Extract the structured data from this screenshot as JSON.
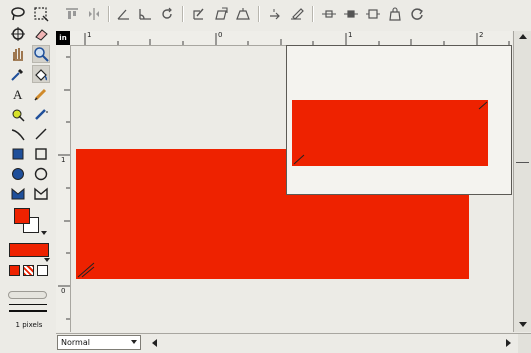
{
  "colors": {
    "shape_fill": "#ee2200",
    "chrome": "#ecebe6",
    "ruler": "#efeee9"
  },
  "toolbox": {
    "tools": [
      {
        "name": "lasso-tool-icon"
      },
      {
        "name": "select-rect-tool-icon"
      },
      {
        "name": "rotate-tool-icon"
      },
      {
        "name": "eraser-tool-icon"
      },
      {
        "name": "pan-hand-tool-icon"
      },
      {
        "name": "zoom-tool-icon"
      },
      {
        "name": "eyedropper-tool-icon"
      },
      {
        "name": "paint-bucket-tool-icon"
      },
      {
        "name": "text-tool-icon"
      },
      {
        "name": "pencil-tool-icon"
      },
      {
        "name": "spray-tool-icon"
      },
      {
        "name": "pen-tool-icon"
      },
      {
        "name": "curve-tool-icon"
      },
      {
        "name": "line-tool-icon"
      },
      {
        "name": "filled-rect-tool-icon"
      },
      {
        "name": "rect-tool-icon"
      },
      {
        "name": "filled-ellipse-tool-icon"
      },
      {
        "name": "ellipse-tool-icon"
      },
      {
        "name": "filled-polygon-tool-icon"
      },
      {
        "name": "polygon-tool-icon"
      }
    ],
    "line_width_label": "1 pixels"
  },
  "rulers": {
    "corner_label": "in",
    "h_ticks": [
      "1",
      "0",
      "1",
      "2"
    ],
    "v_ticks": [
      "1",
      "0"
    ]
  },
  "statusbar": {
    "blend_mode": "Normal"
  },
  "toolbar": {
    "buttons": [
      {
        "name": "align-top-icon"
      },
      {
        "name": "flip-icon"
      },
      {
        "name": "angle-tool-icon"
      },
      {
        "name": "measure-tool-icon"
      },
      {
        "name": "undo-rotate-icon"
      },
      {
        "name": "gradient-tool-icon"
      },
      {
        "name": "transform-tool-icon"
      },
      {
        "name": "perspective-tool-icon"
      },
      {
        "name": "curve-back-icon"
      },
      {
        "name": "edit-shape-icon"
      },
      {
        "name": "node-1-icon"
      },
      {
        "name": "node-2-icon"
      },
      {
        "name": "node-3-icon"
      },
      {
        "name": "bag-icon"
      },
      {
        "name": "refresh-icon"
      }
    ]
  }
}
